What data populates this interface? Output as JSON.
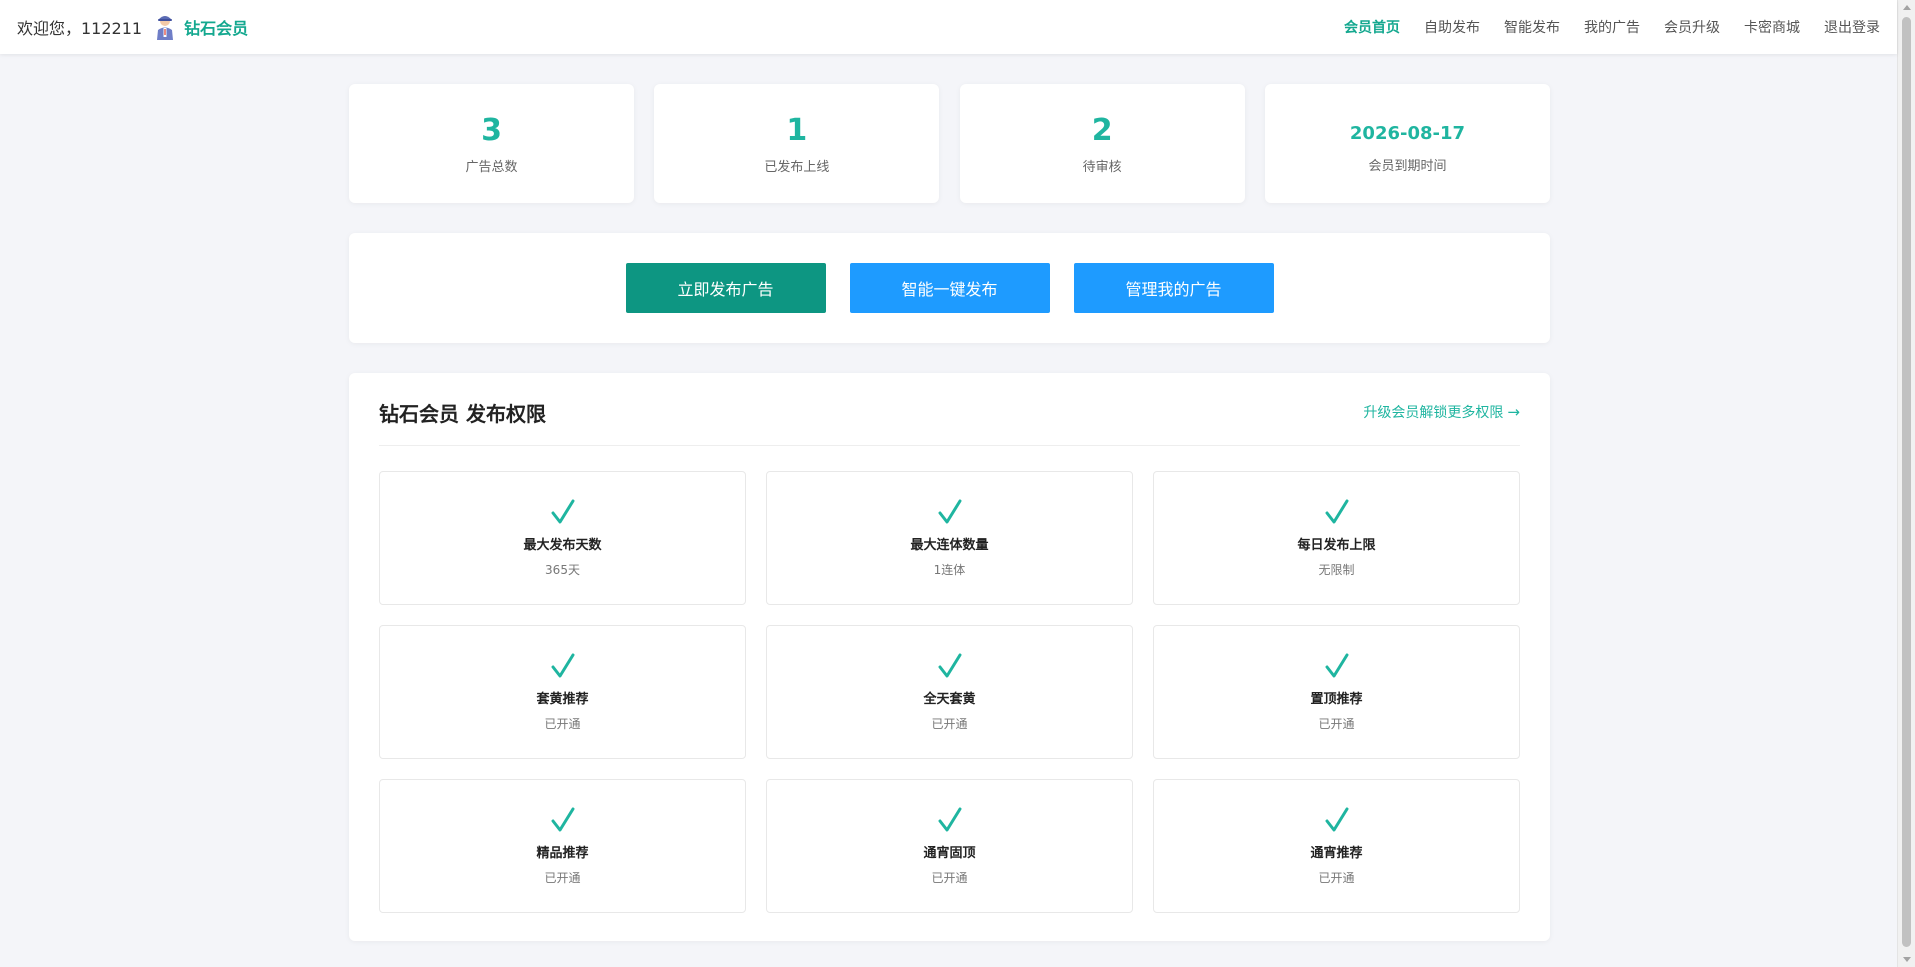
{
  "header": {
    "welcome": "欢迎您，112211",
    "level_name": "钻石会员",
    "nav": [
      {
        "label": "会员首页",
        "active": true
      },
      {
        "label": "自助发布",
        "active": false
      },
      {
        "label": "智能发布",
        "active": false
      },
      {
        "label": "我的广告",
        "active": false
      },
      {
        "label": "会员升级",
        "active": false
      },
      {
        "label": "卡密商城",
        "active": false
      },
      {
        "label": "退出登录",
        "active": false
      }
    ]
  },
  "stats": [
    {
      "value": "3",
      "label": "广告总数"
    },
    {
      "value": "1",
      "label": "已发布上线"
    },
    {
      "value": "2",
      "label": "待审核"
    },
    {
      "value": "2026-08-17",
      "label": "会员到期时间"
    }
  ],
  "actions": {
    "publish_now": "立即发布广告",
    "smart_publish": "智能一键发布",
    "manage_ads": "管理我的广告"
  },
  "permissions": {
    "title": "钻石会员 发布权限",
    "upgrade_link": "升级会员解锁更多权限",
    "upgrade_arrow": "→",
    "items": [
      {
        "icon": "check-icon",
        "name": "最大发布天数",
        "value": "365天"
      },
      {
        "icon": "check-icon",
        "name": "最大连体数量",
        "value": "1连体"
      },
      {
        "icon": "check-icon",
        "name": "每日发布上限",
        "value": "无限制"
      },
      {
        "icon": "check-icon",
        "name": "套黄推荐",
        "value": "已开通"
      },
      {
        "icon": "check-icon",
        "name": "全天套黄",
        "value": "已开通"
      },
      {
        "icon": "check-icon",
        "name": "置顶推荐",
        "value": "已开通"
      },
      {
        "icon": "check-icon",
        "name": "精品推荐",
        "value": "已开通"
      },
      {
        "icon": "check-icon",
        "name": "通宵固顶",
        "value": "已开通"
      },
      {
        "icon": "check-icon",
        "name": "通宵推荐",
        "value": "已开通"
      }
    ]
  },
  "colors": {
    "accent": "#1fb5a0",
    "primary_button": "#0d9682",
    "secondary_button": "#1e9bff",
    "page_background": "#f4f5f9"
  }
}
